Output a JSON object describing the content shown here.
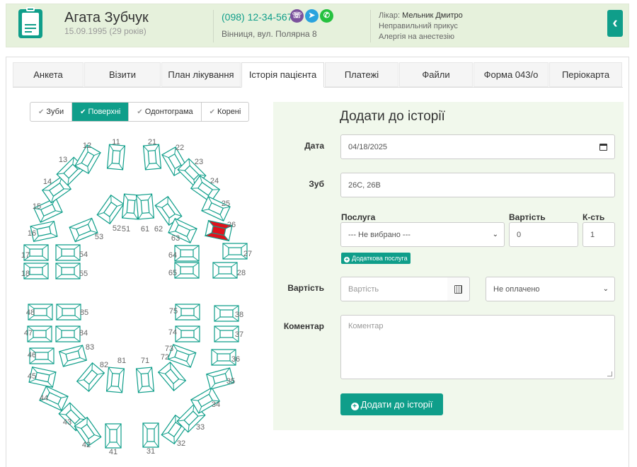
{
  "patient": {
    "name": "Агата Зубчук",
    "dob": "15.09.1995 (29 років)",
    "phone": "(098) 12-34-567",
    "address": "Вінниця, вул. Полярна 8",
    "doctor_label": "Лікар:",
    "doctor_name": "Мельник Дмитро",
    "notes": [
      "Неправильний прикус",
      "Алергія на анестезію"
    ]
  },
  "messengers": [
    {
      "name": "viber-icon",
      "glyph": "☏",
      "color": "#7b519d"
    },
    {
      "name": "telegram-icon",
      "glyph": "➤",
      "color": "#2aa3de"
    },
    {
      "name": "whatsapp-icon",
      "glyph": "✆",
      "color": "#25c13f"
    }
  ],
  "tabs": [
    "Анкета",
    "Візити",
    "План лікування",
    "Історія пацієнта",
    "Платежі",
    "Файли",
    "Форма 043/о",
    "Періокарта"
  ],
  "active_tab": 3,
  "chart_modes": [
    "Зуби",
    "Поверхні",
    "Одонтограма",
    "Корені"
  ],
  "active_mode": 1,
  "accent": "#0f9e8a",
  "selected_color": "#e0121c",
  "teeth": {
    "permanent_upper": [
      "18",
      "17",
      "16",
      "15",
      "14",
      "13",
      "12",
      "11",
      "21",
      "22",
      "23",
      "24",
      "25",
      "26",
      "27",
      "28"
    ],
    "primary_upper": [
      "55",
      "54",
      "53",
      "52",
      "51",
      "61",
      "62",
      "63",
      "64",
      "65"
    ],
    "primary_lower": [
      "85",
      "84",
      "83",
      "82",
      "81",
      "71",
      "72",
      "73",
      "74",
      "75"
    ],
    "permanent_lower": [
      "48",
      "47",
      "46",
      "45",
      "44",
      "43",
      "42",
      "41",
      "31",
      "32",
      "33",
      "34",
      "35",
      "36",
      "37",
      "38"
    ],
    "selected": "26"
  },
  "form": {
    "title": "Додати до історії",
    "date_label": "Дата",
    "date_value": "04/18/2025",
    "tooth_label": "Зуб",
    "tooth_value": "26C, 26B",
    "service_label": "Послуга",
    "service_value": "--- Не вибрано ---",
    "cost_label": "Вартість",
    "cost_value": "0",
    "qty_label": "К-сть",
    "qty_value": "1",
    "add_service": "Додаткова послуга",
    "price_label": "Вартість",
    "price_placeholder": "Вартість",
    "payment_value": "Не оплачено",
    "comment_label": "Коментар",
    "comment_placeholder": "Коментар",
    "submit": "Додати до історії"
  }
}
